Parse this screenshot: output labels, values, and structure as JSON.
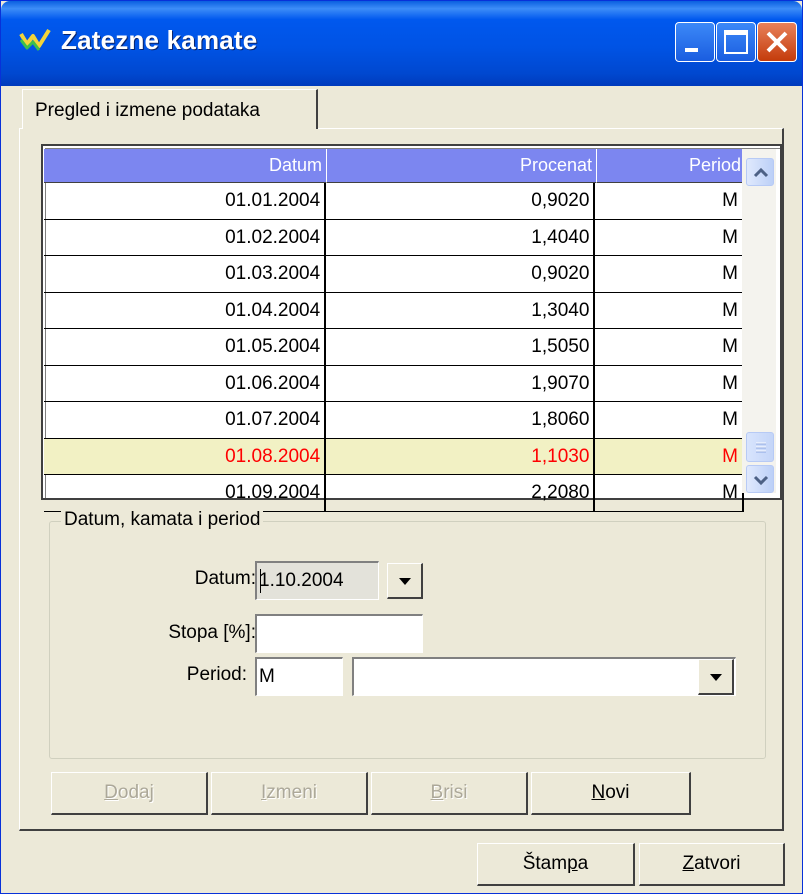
{
  "window": {
    "title": "Zatezne kamate"
  },
  "tab": {
    "label": "Pregled i izmene podataka"
  },
  "grid": {
    "columns": [
      "Datum",
      "Procenat",
      "Period"
    ],
    "rows": [
      {
        "datum": "01.01.2004",
        "procenat": "0,9020",
        "period": "M"
      },
      {
        "datum": "01.02.2004",
        "procenat": "1,4040",
        "period": "M"
      },
      {
        "datum": "01.03.2004",
        "procenat": "0,9020",
        "period": "M"
      },
      {
        "datum": "01.04.2004",
        "procenat": "1,3040",
        "period": "M"
      },
      {
        "datum": "01.05.2004",
        "procenat": "1,5050",
        "period": "M"
      },
      {
        "datum": "01.06.2004",
        "procenat": "1,9070",
        "period": "M"
      },
      {
        "datum": "01.07.2004",
        "procenat": "1,8060",
        "period": "M"
      },
      {
        "datum": "01.08.2004",
        "procenat": "1,1030",
        "period": "M"
      },
      {
        "datum": "01.09.2004",
        "procenat": "2,2080",
        "period": "M"
      }
    ],
    "selected_row_text_color": "#FF0000",
    "header_color": "#7C86F0"
  },
  "form": {
    "group_title": "Datum, kamata i period",
    "datum_label": "Datum:",
    "datum_value": "1.10.2004",
    "stopa_label": "Stopa [%]:",
    "stopa_value": "",
    "period_label": "Period:",
    "period_code": "M",
    "period_select_value": ""
  },
  "actions": {
    "dodaj": {
      "first": "D",
      "rest": "odaj"
    },
    "izmeni": {
      "first": "I",
      "rest": "zmeni"
    },
    "brisi": {
      "first": "B",
      "rest": "risi"
    },
    "novi": {
      "first": "N",
      "rest": "ovi"
    }
  },
  "footer": {
    "stampa": {
      "before": "Štam",
      "underlined": "p",
      "after": "a"
    },
    "zatvori": {
      "first": "Z",
      "rest": "atvori"
    }
  }
}
